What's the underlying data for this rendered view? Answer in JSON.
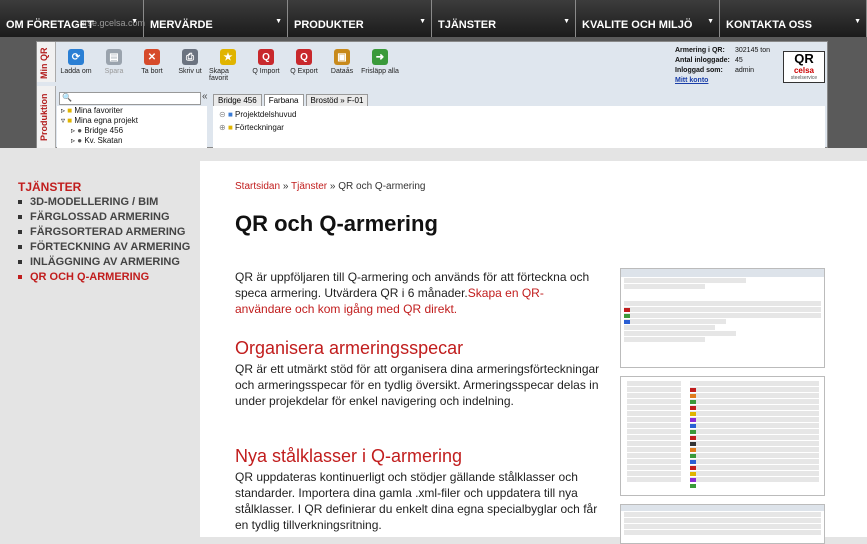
{
  "nav": {
    "items": [
      {
        "label": "OM FÖRETAGET"
      },
      {
        "label": "MERVÄRDE"
      },
      {
        "label": "PRODUKTER"
      },
      {
        "label": "TJÄNSTER"
      },
      {
        "label": "KVALITE OCH MILJÖ"
      },
      {
        "label": "KONTAKTA OSS"
      }
    ],
    "ghost_url": "...arse.gcelsa.com"
  },
  "app_screenshot": {
    "vertical_tabs": [
      "Min QR",
      "Produktion"
    ],
    "ribbon": [
      {
        "label": "Ladda om",
        "icon": "refresh-icon",
        "color": "#2a7fd4",
        "disabled": false
      },
      {
        "label": "Spara",
        "icon": "save-icon",
        "color": "#9aa3ad",
        "disabled": true
      },
      {
        "label": "Ta bort",
        "icon": "delete-icon",
        "color": "#d64a2a",
        "disabled": false
      },
      {
        "label": "Skriv ut",
        "icon": "print-icon",
        "color": "#6b7380",
        "disabled": false
      },
      {
        "label": "Skapa favorit",
        "icon": "star-icon",
        "color": "#e0b400",
        "disabled": false
      },
      {
        "label": "Q Import",
        "icon": "q-import-icon",
        "color": "#c8282c",
        "disabled": false
      },
      {
        "label": "Q Export",
        "icon": "q-export-icon",
        "color": "#c8282c",
        "disabled": false
      },
      {
        "label": "Dataås",
        "icon": "lock-icon",
        "color": "#c88a1c",
        "disabled": false
      },
      {
        "label": "Frisläpp alla",
        "icon": "release-icon",
        "color": "#3a9a3a",
        "disabled": false
      }
    ],
    "account": {
      "armering_label": "Armering i QR:",
      "armering_value": "302145 ton",
      "antal_label": "Antal inloggade:",
      "antal_value": "45",
      "inloggad_label": "Inloggad som:",
      "inloggad_value": "admin",
      "mitt_konto": "Mitt konto"
    },
    "logo": {
      "q": "QR",
      "celsa": "celsa",
      "sub": "steelservice"
    },
    "tree": [
      "Mina favoriter",
      "Mina egna projekt",
      "Bridge 456",
      "Kv. Skatan"
    ],
    "doc_tabs": [
      "Bridge 456",
      "Farbana",
      "Brostöd » F-01"
    ],
    "doc_items": [
      "Projektdelshuvud",
      "Förteckningar"
    ]
  },
  "sidebar": {
    "title": "TJÄNSTER",
    "items": [
      {
        "label": "3D-MODELLERING / BIM",
        "current": false
      },
      {
        "label": "FÄRGLOSSAD ARMERING",
        "current": false
      },
      {
        "label": "FÄRGSORTERAD ARMERING",
        "current": false
      },
      {
        "label": "FÖRTECKNING AV ARMERING",
        "current": false
      },
      {
        "label": "INLÄGGNING AV ARMERING",
        "current": false
      },
      {
        "label": "QR OCH Q-ARMERING",
        "current": true
      }
    ]
  },
  "breadcrumb": {
    "home": "Startsidan",
    "sep1": "»",
    "section": "Tjänster",
    "sep2": "»",
    "current": "QR och Q-armering"
  },
  "main": {
    "title": "QR och Q-armering",
    "intro": "QR är uppföljaren till Q-armering och används för att förteckna och speca armering. Utvärdera QR i 6 månader.",
    "intro_link": "Skapa en QR-användare och kom igång med QR direkt.",
    "sections": [
      {
        "heading": "Organisera armeringsspecar",
        "text": "QR är ett utmärkt stöd för att organisera dina armeringsförteckningar och armeringsspecar för en tydlig översikt. Armeringsspecar delas in under projekdelar för enkel navigering och indelning."
      },
      {
        "heading": "Nya stålklasser i Q-armering",
        "text": "QR uppdateras kontinuerligt och stödjer gällande stålklasser och standarder. Importera dina gamla .xml-filer och uppdatera till nya stålklasser. I QR definierar du enkelt dina egna specialbyglar och får en tydlig tillverkningsritning."
      }
    ]
  },
  "colors": {
    "accent": "#c11d1d",
    "nav_bg": "#1b1b1b",
    "sidebar_bg": "#e4e4e4"
  }
}
